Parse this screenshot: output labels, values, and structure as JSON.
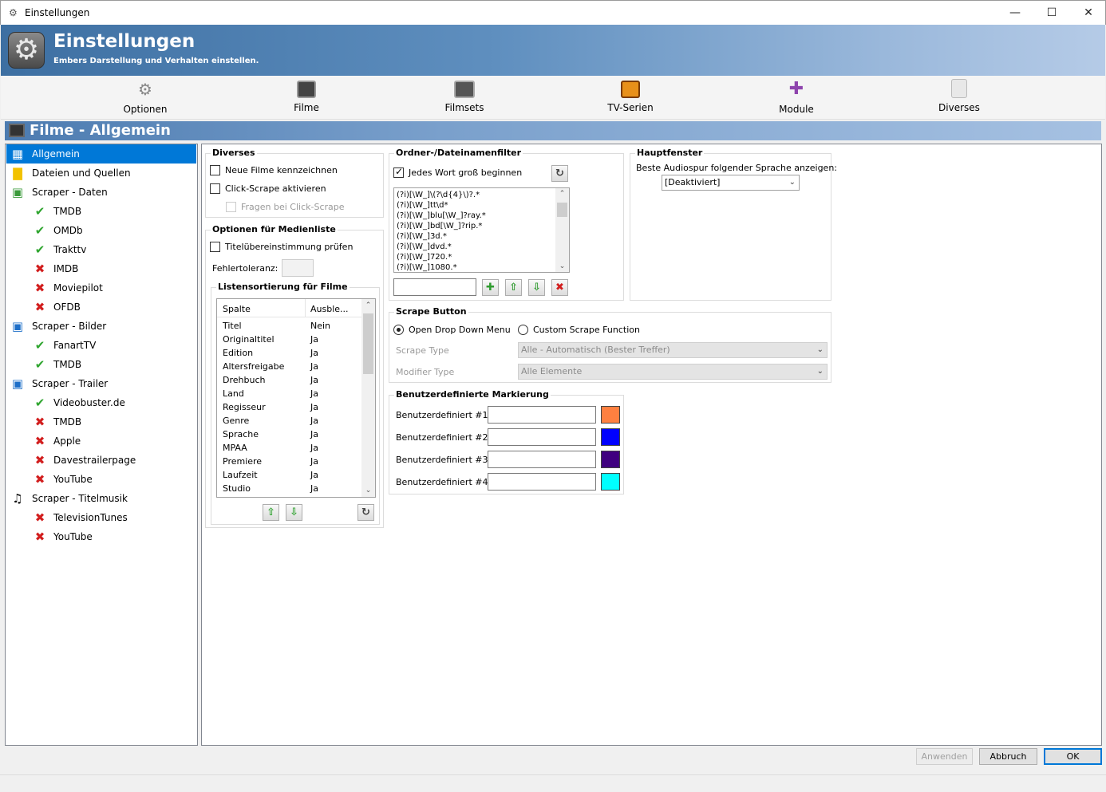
{
  "window": {
    "title": "Einstellungen",
    "minimize": "—",
    "maximize": "☐",
    "close": "✕"
  },
  "header": {
    "title": "Einstellungen",
    "subtitle": "Embers Darstellung und Verhalten einstellen."
  },
  "toolbar": [
    "Optionen",
    "Filme",
    "Filmsets",
    "TV-Serien",
    "Module",
    "Diverses"
  ],
  "section": {
    "title": "Filme - Allgemein"
  },
  "tree": [
    {
      "label": "Allgemein",
      "icon": "film-icon",
      "level": 0,
      "selected": true
    },
    {
      "label": "Dateien und Quellen",
      "icon": "folder-icon",
      "level": 0
    },
    {
      "label": "Scraper - Daten",
      "icon": "data-scraper-icon",
      "level": 0
    },
    {
      "label": "TMDB",
      "icon": "check-icon",
      "level": 1
    },
    {
      "label": "OMDb",
      "icon": "check-icon",
      "level": 1
    },
    {
      "label": "Trakttv",
      "icon": "check-icon",
      "level": 1
    },
    {
      "label": "IMDB",
      "icon": "cross-icon",
      "level": 1
    },
    {
      "label": "Moviepilot",
      "icon": "cross-icon",
      "level": 1
    },
    {
      "label": "OFDB",
      "icon": "cross-icon",
      "level": 1
    },
    {
      "label": "Scraper - Bilder",
      "icon": "image-scraper-icon",
      "level": 0
    },
    {
      "label": "FanartTV",
      "icon": "check-icon",
      "level": 1
    },
    {
      "label": "TMDB",
      "icon": "check-icon",
      "level": 1
    },
    {
      "label": "Scraper - Trailer",
      "icon": "trailer-scraper-icon",
      "level": 0
    },
    {
      "label": "Videobuster.de",
      "icon": "check-icon",
      "level": 1
    },
    {
      "label": "TMDB",
      "icon": "cross-icon",
      "level": 1
    },
    {
      "label": "Apple",
      "icon": "cross-icon",
      "level": 1
    },
    {
      "label": "Davestrailerpage",
      "icon": "cross-icon",
      "level": 1
    },
    {
      "label": "YouTube",
      "icon": "cross-icon",
      "level": 1
    },
    {
      "label": "Scraper - Titelmusik",
      "icon": "music-note-icon",
      "level": 0
    },
    {
      "label": "TelevisionTunes",
      "icon": "cross-icon",
      "level": 1
    },
    {
      "label": "YouTube",
      "icon": "cross-icon",
      "level": 1
    }
  ],
  "diverses": {
    "title": "Diverses",
    "new_movies": "Neue Filme kennzeichnen",
    "click_scrape": "Click-Scrape aktivieren",
    "ask_click_scrape": "Fragen bei Click-Scrape"
  },
  "medialist": {
    "title": "Optionen für Medienliste",
    "title_match": "Titelübereinstimmung prüfen",
    "tolerance_label": "Fehlertoleranz:",
    "tolerance_value": "",
    "sort_title": "Listensortierung für Filme",
    "col_headers": [
      "Spalte",
      "Ausble..."
    ],
    "rows": [
      [
        "Titel",
        "Nein"
      ],
      [
        "Originaltitel",
        "Ja"
      ],
      [
        "Edition",
        "Ja"
      ],
      [
        "Altersfreigabe",
        "Ja"
      ],
      [
        "Drehbuch",
        "Ja"
      ],
      [
        "Land",
        "Ja"
      ],
      [
        "Regisseur",
        "Ja"
      ],
      [
        "Genre",
        "Ja"
      ],
      [
        "Sprache",
        "Ja"
      ],
      [
        "MPAA",
        "Ja"
      ],
      [
        "Premiere",
        "Ja"
      ],
      [
        "Laufzeit",
        "Ja"
      ],
      [
        "Studio",
        "Ja"
      ]
    ]
  },
  "filter": {
    "title": "Ordner-/Dateinamenfilter",
    "capitalize": "Jedes Wort groß beginnen",
    "patterns": [
      "(?i)[\\W_]\\(?\\d{4}\\)?.*",
      "(?i)[\\W_]tt\\d*",
      "(?i)[\\W_]blu[\\W_]?ray.*",
      "(?i)[\\W_]bd[\\W_]?rip.*",
      "(?i)[\\W_]3d.*",
      "(?i)[\\W_]dvd.*",
      "(?i)[\\W_]720.*",
      "(?i)[\\W_]1080.*"
    ],
    "new_pattern": ""
  },
  "mainwindow": {
    "title": "Hauptfenster",
    "audio_label": "Beste Audiospur folgender Sprache anzeigen:",
    "audio_value": "[Deaktiviert]"
  },
  "scrape_button": {
    "title": "Scrape Button",
    "option_dropdown": "Open Drop Down Menu",
    "option_custom": "Custom Scrape Function",
    "type_label": "Scrape Type",
    "type_value": "Alle - Automatisch (Bester Treffer)",
    "modifier_label": "Modifier Type",
    "modifier_value": "Alle Elemente"
  },
  "custom_marks": {
    "title": "Benutzerdefinierte Markierung",
    "items": [
      {
        "label": "Benutzerdefiniert #1",
        "value": "",
        "color": "#ff8040"
      },
      {
        "label": "Benutzerdefiniert #2",
        "value": "",
        "color": "#0000ff"
      },
      {
        "label": "Benutzerdefiniert #3",
        "value": "",
        "color": "#400080"
      },
      {
        "label": "Benutzerdefiniert #4",
        "value": "",
        "color": "#00ffff"
      }
    ]
  },
  "footer": {
    "apply": "Anwenden",
    "cancel": "Abbruch",
    "ok": "OK"
  }
}
